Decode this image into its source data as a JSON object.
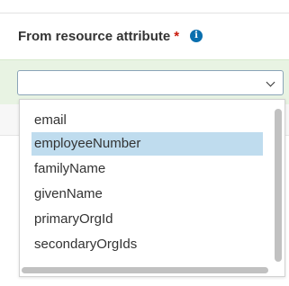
{
  "field": {
    "label": "From resource attribute",
    "required_marker": "*",
    "info_icon_glyph": "i"
  },
  "select": {
    "value": ""
  },
  "dropdown": {
    "options": [
      {
        "label": "email",
        "selected": false
      },
      {
        "label": "employeeNumber",
        "selected": true
      },
      {
        "label": "familyName",
        "selected": false
      },
      {
        "label": "givenName",
        "selected": false
      },
      {
        "label": "primaryOrgId",
        "selected": false
      },
      {
        "label": "secondaryOrgIds",
        "selected": false
      }
    ]
  },
  "icons": {
    "info": "info-icon",
    "chevron": "chevron-down-icon"
  },
  "colors": {
    "required": "#c9190b",
    "info_icon": "#0a6fae",
    "selected_option_bg": "#bfdcee",
    "band_bg": "#e8f3e3"
  }
}
